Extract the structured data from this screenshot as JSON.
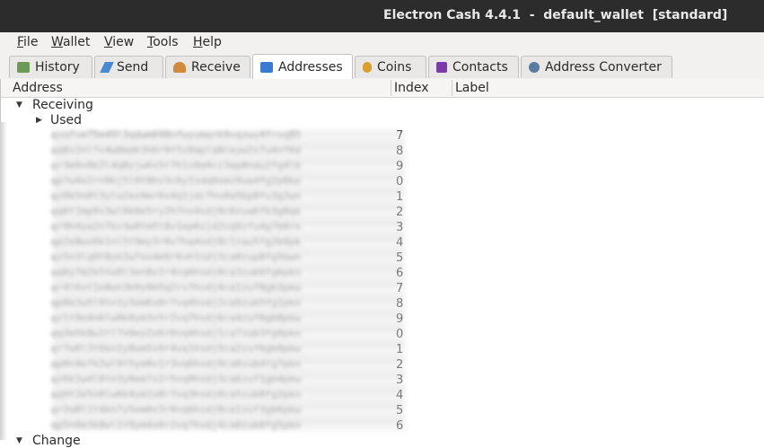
{
  "window": {
    "title": "Electron Cash 4.4.1  -  default_wallet  [standard]"
  },
  "menu": [
    {
      "first": "F",
      "rest": "ile"
    },
    {
      "first": "W",
      "rest": "allet"
    },
    {
      "first": "V",
      "rest": "iew"
    },
    {
      "first": "T",
      "rest": "ools"
    },
    {
      "first": "H",
      "rest": "elp"
    }
  ],
  "tabs": [
    {
      "label": "History",
      "icon": "history-icon",
      "color": "#6a9a55"
    },
    {
      "label": "Send",
      "icon": "send-icon",
      "color": "#4a8ad0"
    },
    {
      "label": "Receive",
      "icon": "receive-icon",
      "color": "#d08a3a"
    },
    {
      "label": "Addresses",
      "icon": "addresses-icon",
      "color": "#3a7ad0",
      "active": true
    },
    {
      "label": "Coins",
      "icon": "coins-icon",
      "color": "#d8a030"
    },
    {
      "label": "Contacts",
      "icon": "contacts-icon",
      "color": "#7a3aa8"
    },
    {
      "label": "Address Converter",
      "icon": "address-converter-icon",
      "color": "#5a7aa0"
    }
  ],
  "columns": {
    "address": "Address",
    "index": "Index",
    "label": "Label"
  },
  "tree": {
    "receiving": "Receiving",
    "used": "Used",
    "change": "Change"
  },
  "rows": [
    {
      "address": "qzqfvm75m49l3qdwm698nfwyumqrk9vqzwy4frxq85",
      "index": "7"
    },
    {
      "address": "qq8x2nl7v4w0mdk3h6r9t5z0aplq8ceyw2s7u4nf6d",
      "index": "8"
    },
    {
      "address": "qr3m9v0k2l4q8yjw6x5t7h1s0a9cz3ep8ndu2fg4lb",
      "index": "9"
    },
    {
      "address": "qp7w4e2rn9kj5l0t8hv3c6y1sdq0xmz9ua4fg2p8ke",
      "index": "0"
    },
    {
      "address": "qz0k5n8t3ylw2ex9mr6v4q1jdc7hs0a5bp8fu3g2wn",
      "index": "1"
    },
    {
      "address": "qq6t1mp9v3wl8k0e5ry2h7nx4sdj9c0zua6fb3g8qk",
      "index": "2"
    },
    {
      "address": "qr9h4ya2n7kx3w0tm5l8v1ep6sjd2cq9zfu4g7b0rn",
      "index": "3"
    },
    {
      "address": "qp2e8wx6k1nl5t9my3r0v7hq4sdj8c1zau5fg2b9pk",
      "index": "4"
    },
    {
      "address": "qz5n3lq0t8yk2w7ex4m9r6vh1sdj3ca0zup8fg5bwn",
      "index": "5"
    },
    {
      "address": "qq0y7m2k5tw9l3en8x1r4vq6hsdj0ca3zub9fg6pkn",
      "index": "6"
    },
    {
      "address": "qr4l6xt1e8wn3k0y9m5q2rv7hsdj4ca1zuf8gb3pkw",
      "index": "7"
    },
    {
      "address": "qp8k2w5l9tn1y3em6x0r7vq4hsdj2ca9zub5fg1pkn",
      "index": "8"
    },
    {
      "address": "qz1t9e4n6lw0k8ym3x5r2vq7hsdj6ca4zuf0gb8pkw",
      "index": "9"
    },
    {
      "address": "qq3m5k8w1tl7n9ey2x6r0vq4hsdj1ca7zub3fg9pkn",
      "index": "0"
    },
    {
      "address": "qr7w0l3t6kn2y8em5x9r4vq1hsdj5ca2zuf6gb0pkw",
      "index": "1"
    },
    {
      "address": "qp0n4e7k2wl9t5ym8x1r3vq6hsdj9ca0zub4fg7pkn",
      "index": "2"
    },
    {
      "address": "qz6k1w4l8tn3y0em7x2r5vq9hsdj3ca6zuf1gb4pkw",
      "index": "3"
    },
    {
      "address": "qq9t2e5n0lw6k4ym1x8r7vq3hsdj0ca5zub8fg2pkn",
      "index": "4"
    },
    {
      "address": "qr2w8l1t4kn7y5em0x3r9vq6hsdj8ca1zuf3gb6pkw",
      "index": "5"
    },
    {
      "address": "qp5n0e3k8wl1t9ym4x6r2vq7hsdj4ca8zub0fg5pkn",
      "index": "6"
    }
  ]
}
